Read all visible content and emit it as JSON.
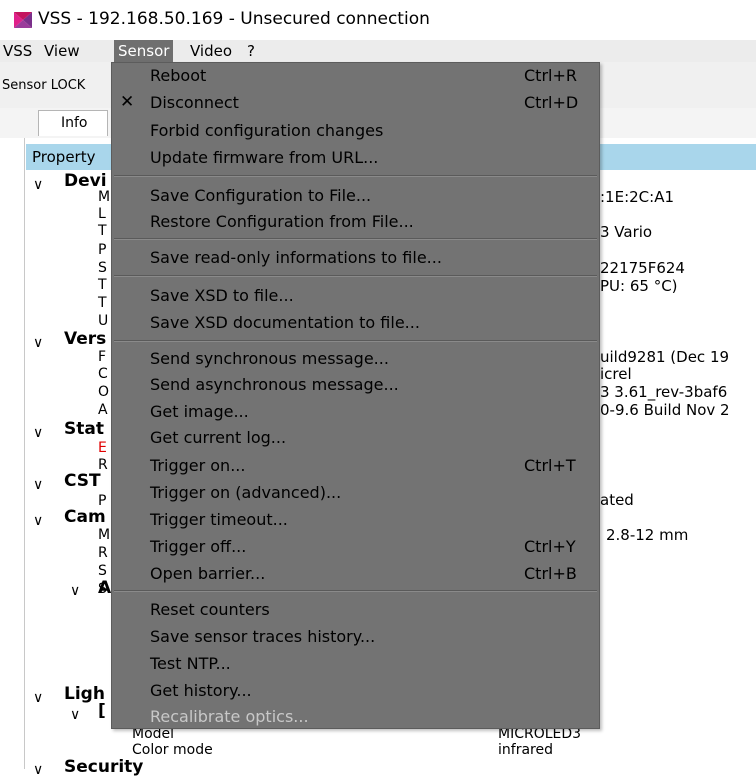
{
  "window": {
    "title": "VSS - 192.168.50.169 - Unsecured connection"
  },
  "menubar": {
    "items": [
      "VSS",
      "View",
      "Sensor",
      "Video",
      "?"
    ]
  },
  "toolbar": {
    "label": "Sensor LOCK"
  },
  "tabs": {
    "info": "Info"
  },
  "grid": {
    "header": "Property"
  },
  "tree": {
    "device": "Devi",
    "device_rows": [
      "M",
      "L",
      "T",
      "P",
      "S",
      "T",
      "T",
      "U"
    ],
    "mac_value": ":1E:2C:A1",
    "type_value": "3 Vario",
    "serial_value": "22175F624",
    "temp_value": "PU: 65 °C)",
    "version": "Vers",
    "version_rows": [
      "F",
      "C",
      "O",
      "A"
    ],
    "fw_value": "uild9281 (Dec 19",
    "c_value": "icrel",
    "os_value": "3 3.61_rev-3baf6",
    "a_value": "0-9.6 Build Nov 2",
    "status": "Stat",
    "status_error": "E",
    "status_row": "R",
    "cst": "CST",
    "cst_row": "P",
    "cst_value": "ated",
    "camera": "Cam",
    "camera_rows": [
      "M",
      "R",
      "S",
      "S"
    ],
    "camera_value": "2.8-12 mm",
    "camera_sub": "A",
    "light": "Ligh",
    "light_sub": "[",
    "model_label": "Model",
    "model_value": "MICROLED3",
    "color_label": "Color mode",
    "color_value": "infrared",
    "security": "Security"
  },
  "menu": {
    "reboot": {
      "label": "Reboot",
      "shortcut": "Ctrl+R"
    },
    "disconnect": {
      "label": "Disconnect",
      "shortcut": "Ctrl+D"
    },
    "forbid": {
      "label": "Forbid configuration changes"
    },
    "update_fw": {
      "label": "Update firmware from URL..."
    },
    "save_cfg": {
      "label": "Save Configuration to File..."
    },
    "restore_cfg": {
      "label": "Restore Configuration from File..."
    },
    "save_ro": {
      "label": "Save read-only informations to file..."
    },
    "save_xsd": {
      "label": "Save XSD to file..."
    },
    "save_xsd_doc": {
      "label": "Save XSD documentation to file..."
    },
    "send_sync": {
      "label": "Send synchronous message..."
    },
    "send_async": {
      "label": "Send asynchronous message..."
    },
    "get_image": {
      "label": "Get image..."
    },
    "get_log": {
      "label": "Get current log..."
    },
    "trigger_on": {
      "label": "Trigger on...",
      "shortcut": "Ctrl+T"
    },
    "trigger_adv": {
      "label": "Trigger on (advanced)..."
    },
    "trigger_timeout": {
      "label": "Trigger timeout..."
    },
    "trigger_off": {
      "label": "Trigger off...",
      "shortcut": "Ctrl+Y"
    },
    "open_barrier": {
      "label": "Open barrier...",
      "shortcut": "Ctrl+B"
    },
    "reset_counters": {
      "label": "Reset counters"
    },
    "save_traces": {
      "label": "Save sensor traces history..."
    },
    "test_ntp": {
      "label": "Test NTP..."
    },
    "get_history": {
      "label": "Get history..."
    },
    "recalibrate": {
      "label": "Recalibrate optics..."
    }
  }
}
